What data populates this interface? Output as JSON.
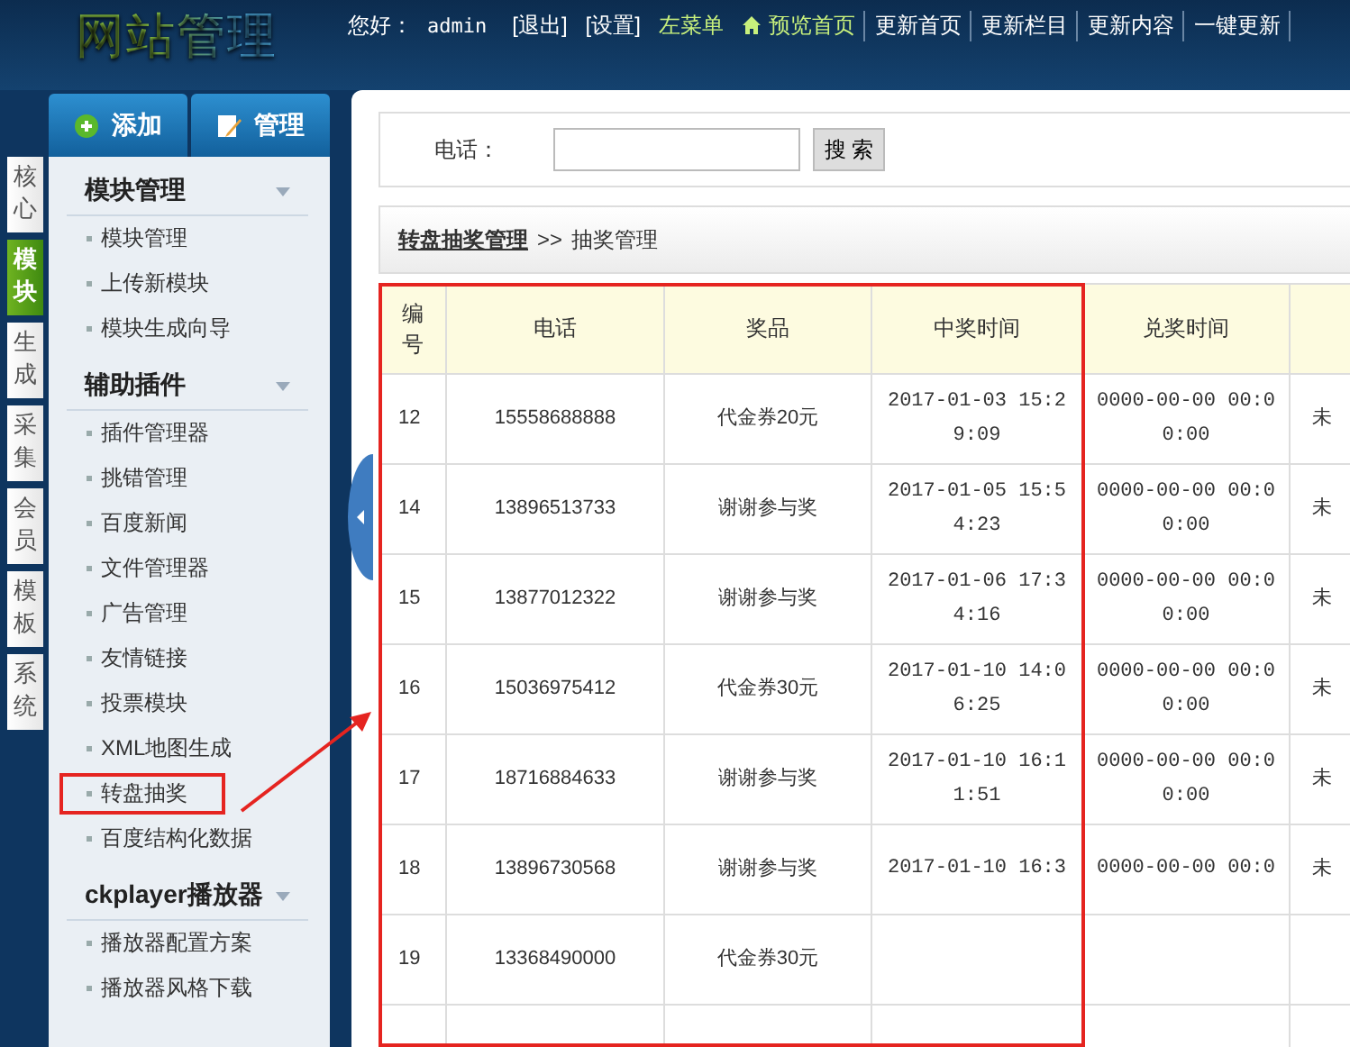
{
  "header": {
    "logo": "网站管理",
    "greeting": "您好：",
    "user": "admin",
    "links": [
      {
        "label": "[退出]",
        "highlight": false,
        "icon": false,
        "separator": false
      },
      {
        "label": "[设置]",
        "highlight": false,
        "icon": false,
        "separator": false
      },
      {
        "label": "左菜单",
        "highlight": true,
        "icon": false,
        "separator": false
      },
      {
        "label": "预览首页",
        "highlight": true,
        "icon": true,
        "separator": true
      },
      {
        "label": "更新首页",
        "highlight": false,
        "icon": false,
        "separator": true
      },
      {
        "label": "更新栏目",
        "highlight": false,
        "icon": false,
        "separator": true
      },
      {
        "label": "更新内容",
        "highlight": false,
        "icon": false,
        "separator": true
      },
      {
        "label": "一键更新",
        "highlight": false,
        "icon": false,
        "separator": true
      }
    ]
  },
  "side_tabs": [
    {
      "label": "核心",
      "selected": false
    },
    {
      "label": "模块",
      "selected": true
    },
    {
      "label": "生成",
      "selected": false
    },
    {
      "label": "采集",
      "selected": false
    },
    {
      "label": "会员",
      "selected": false
    },
    {
      "label": "模板",
      "selected": false
    },
    {
      "label": "系统",
      "selected": false
    }
  ],
  "sidebar": {
    "buttons": [
      {
        "label": "添加",
        "kind": "add"
      },
      {
        "label": "管理",
        "kind": "edit"
      }
    ],
    "sections": [
      {
        "title": "模块管理",
        "items": [
          {
            "label": "模块管理",
            "highlighted": false
          },
          {
            "label": "上传新模块",
            "highlighted": false
          },
          {
            "label": "模块生成向导",
            "highlighted": false
          }
        ]
      },
      {
        "title": "辅助插件",
        "items": [
          {
            "label": "插件管理器",
            "highlighted": false
          },
          {
            "label": "挑错管理",
            "highlighted": false
          },
          {
            "label": "百度新闻",
            "highlighted": false
          },
          {
            "label": "文件管理器",
            "highlighted": false
          },
          {
            "label": "广告管理",
            "highlighted": false
          },
          {
            "label": "友情链接",
            "highlighted": false
          },
          {
            "label": "投票模块",
            "highlighted": false
          },
          {
            "label": "XML地图生成",
            "highlighted": false
          },
          {
            "label": "转盘抽奖",
            "highlighted": true
          },
          {
            "label": "百度结构化数据",
            "highlighted": false
          }
        ]
      },
      {
        "title": "ckplayer播放器",
        "items": [
          {
            "label": "播放器配置方案",
            "highlighted": false
          },
          {
            "label": "播放器风格下载",
            "highlighted": false
          }
        ]
      }
    ]
  },
  "search": {
    "label": "电话：",
    "button": "搜 索"
  },
  "breadcrumb": {
    "link": "转盘抽奖管理",
    "separator": ">>",
    "current": "抽奖管理"
  },
  "table": {
    "columns": [
      "编号",
      "电话",
      "奖品",
      "中奖时间",
      "兑奖时间",
      ""
    ],
    "rows": [
      [
        "12",
        "15558688888",
        "代金券20元",
        "2017-01-03 15:29:09",
        "0000-00-00 00:00:00",
        "未"
      ],
      [
        "14",
        "13896513733",
        "谢谢参与奖",
        "2017-01-05 15:54:23",
        "0000-00-00 00:00:00",
        "未"
      ],
      [
        "15",
        "13877012322",
        "谢谢参与奖",
        "2017-01-06 17:34:16",
        "0000-00-00 00:00:00",
        "未"
      ],
      [
        "16",
        "15036975412",
        "代金券30元",
        "2017-01-10 14:06:25",
        "0000-00-00 00:00:00",
        "未"
      ],
      [
        "17",
        "18716884633",
        "谢谢参与奖",
        "2017-01-10 16:11:51",
        "0000-00-00 00:00:00",
        "未"
      ],
      [
        "18",
        "13896730568",
        "谢谢参与奖",
        "2017-01-10 16:3",
        "0000-00-00 00:0",
        "未"
      ],
      [
        "19",
        "13368490000",
        "代金券30元",
        "",
        "",
        ""
      ],
      [
        "",
        "",
        "",
        "",
        "",
        ""
      ]
    ]
  }
}
